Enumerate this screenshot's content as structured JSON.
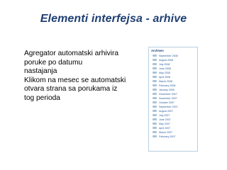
{
  "slide": {
    "title": "Elementi interfejsa - arhive",
    "body_lines": [
      "Agregator automatski arhivira",
      "poruke po datumu",
      "nastajanja",
      "Klikom na mesec se automatski",
      "otvara strana sa porukama iz",
      "tog perioda"
    ]
  },
  "archives": {
    "heading": "Archives",
    "icon": "arrow-icon",
    "items": [
      "September 2008",
      "August 2008",
      "July 2008",
      "June 2008",
      "May 2008",
      "April 2008",
      "March 2008",
      "February 2008",
      "January 2008",
      "December 2007",
      "November 2007",
      "October 2007",
      "September 2007",
      "August 2007",
      "July 2007",
      "June 2007",
      "May 2007",
      "April 2007",
      "March 2007",
      "February 2007"
    ]
  },
  "colors": {
    "title": "#1f3f73",
    "link": "#2a5d9c",
    "panel_border": "#b9cfe0"
  }
}
